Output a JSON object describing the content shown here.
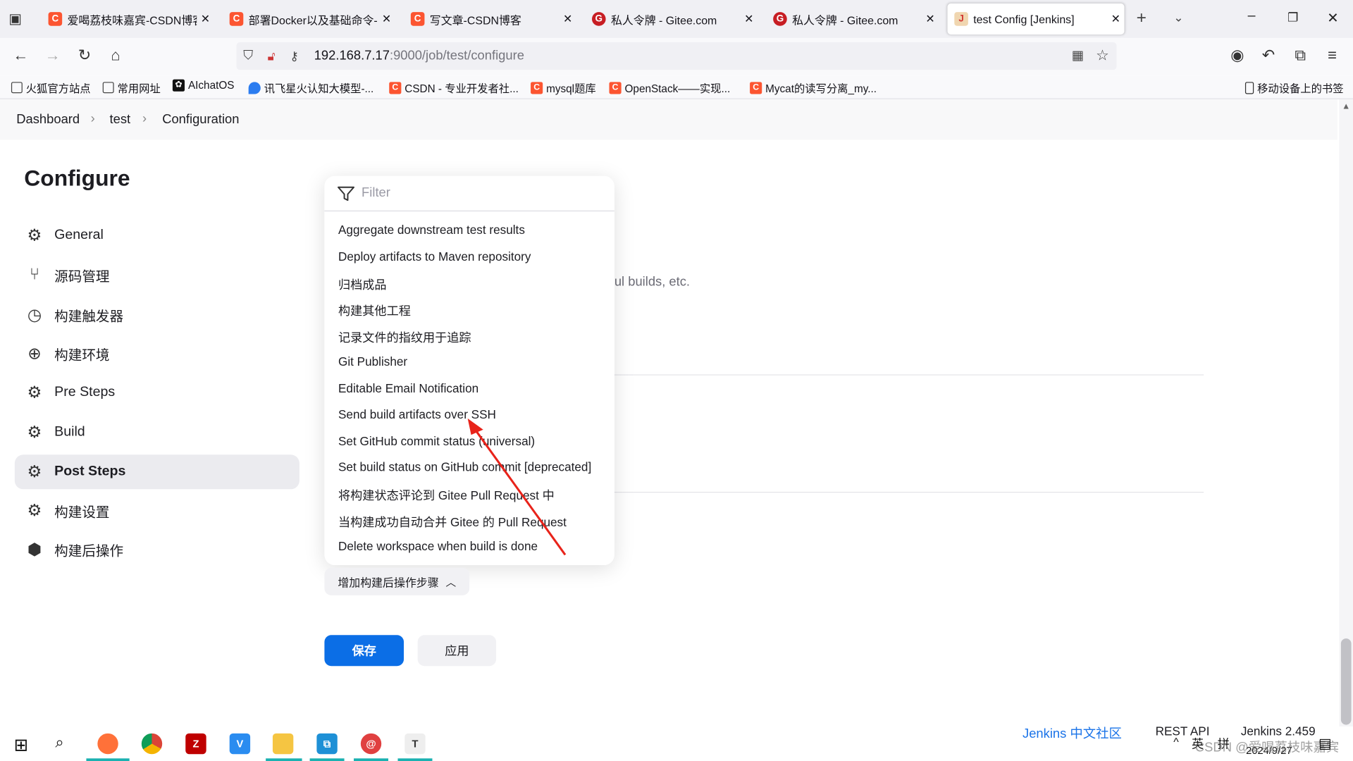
{
  "browser": {
    "tabs": [
      {
        "title": "爱喝荔枝味嘉宾-CSDN博客",
        "icon": "csdn-icon",
        "color": "#fc5531"
      },
      {
        "title": "部署Docker以及基础命令-C",
        "icon": "csdn-icon",
        "color": "#fc5531"
      },
      {
        "title": "写文章-CSDN博客",
        "icon": "csdn-icon",
        "color": "#fc5531"
      },
      {
        "title": "私人令牌 - Gitee.com",
        "icon": "gitee-icon",
        "color": "#c71d23"
      },
      {
        "title": "私人令牌 - Gitee.com",
        "icon": "gitee-icon",
        "color": "#c71d23"
      },
      {
        "title": "test Config [Jenkins]",
        "icon": "jenkins-icon",
        "color": "#d33833",
        "active": true
      }
    ],
    "url_host": "192.168.7.17",
    "url_path": ":9000/job/test/configure",
    "bookmarks": [
      {
        "label": "火狐官方站点",
        "icon": "folder-icon"
      },
      {
        "label": "常用网址",
        "icon": "folder-icon"
      },
      {
        "label": "AIchatOS",
        "icon": "openai-icon"
      },
      {
        "label": "讯飞星火认知大模型-...",
        "icon": "spark-icon"
      },
      {
        "label": "CSDN - 专业开发者社...",
        "icon": "csdn-icon"
      },
      {
        "label": "mysql题库",
        "icon": "csdn-icon"
      },
      {
        "label": "OpenStack——实现...",
        "icon": "csdn-icon"
      },
      {
        "label": "Mycat的读写分离_my...",
        "icon": "csdn-icon"
      }
    ],
    "mobile_bookmarks": "移动设备上的书签"
  },
  "breadcrumb": [
    "Dashboard",
    "test",
    "Configuration"
  ],
  "sidebar": {
    "title": "Configure",
    "items": [
      {
        "label": "General",
        "icon": "gear-icon"
      },
      {
        "label": "源码管理",
        "icon": "branch-icon"
      },
      {
        "label": "构建触发器",
        "icon": "clock-icon"
      },
      {
        "label": "构建环境",
        "icon": "globe-icon"
      },
      {
        "label": "Pre Steps",
        "icon": "gear-icon"
      },
      {
        "label": "Build",
        "icon": "gear-icon"
      },
      {
        "label": "Post Steps",
        "icon": "gear-icon",
        "active": true
      },
      {
        "label": "构建设置",
        "icon": "gear-icon"
      },
      {
        "label": "构建后操作",
        "icon": "package-icon"
      }
    ]
  },
  "background_text": "ul builds, etc.",
  "dropdown": {
    "filter_placeholder": "Filter",
    "items": [
      "Aggregate downstream test results",
      "Deploy artifacts to Maven repository",
      "归档成品",
      "构建其他工程",
      "记录文件的指纹用于追踪",
      "Git Publisher",
      "Editable Email Notification",
      "Send build artifacts over SSH",
      "Set GitHub commit status (universal)",
      "Set build status on GitHub commit [deprecated]",
      "将构建状态评论到 Gitee Pull Request 中",
      "当构建成功自动合并 Gitee 的 Pull Request",
      "Delete workspace when build is done"
    ]
  },
  "add_post_build_button": "增加构建后操作步骤",
  "save_button": "保存",
  "apply_button": "应用",
  "footer": {
    "community": "Jenkins 中文社区",
    "rest_api": "REST API",
    "version": "Jenkins 2.459"
  },
  "tray": {
    "ime_lang": "英",
    "ime_mode": "拼",
    "date": "2024/9/27",
    "watermark": "CSDN @爱喝荔枝味嘉宾"
  },
  "colors": {
    "primary": "#0b6ee6",
    "link": "#1a73e8",
    "annotation_arrow": "#e8231a"
  }
}
